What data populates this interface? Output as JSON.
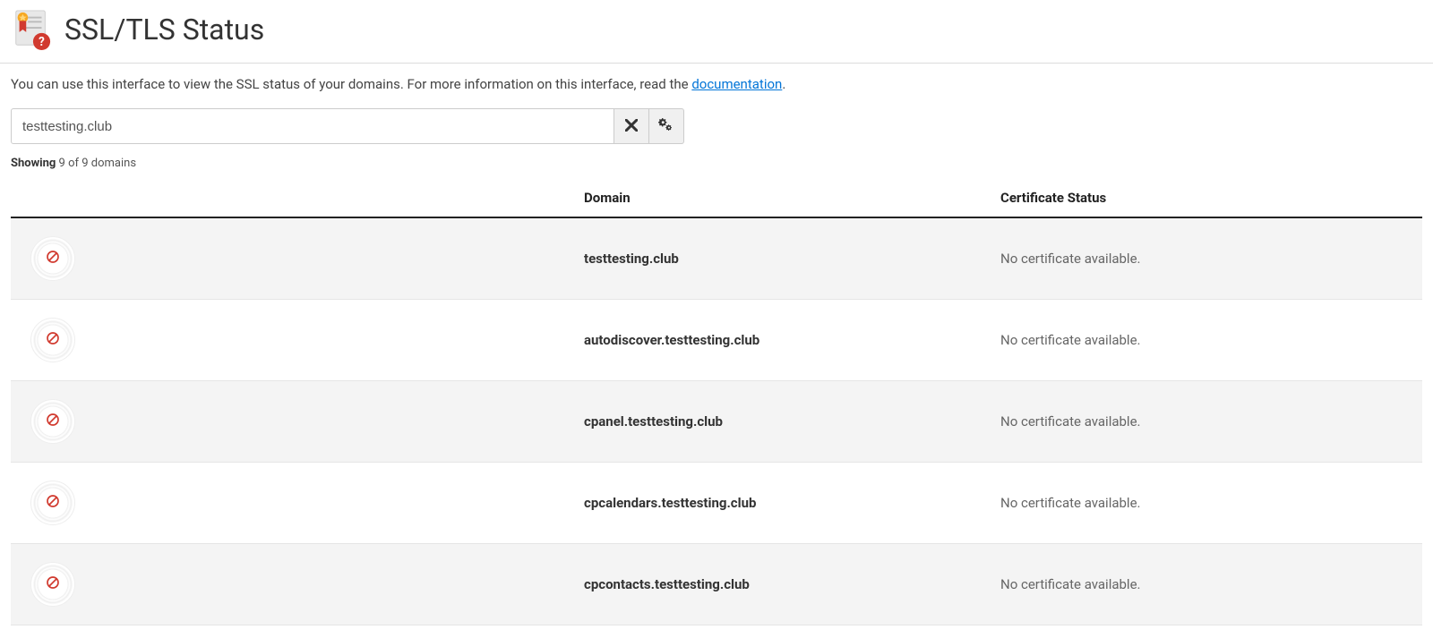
{
  "header": {
    "title": "SSL/TLS Status"
  },
  "intro": {
    "text_before_link": "You can use this interface to view the SSL status of your domains. For more information on this interface, read the ",
    "link_text": "documentation",
    "text_after_link": "."
  },
  "search": {
    "value": "testtesting.club"
  },
  "showing": {
    "label": "Showing",
    "rest": " 9 of 9 domains"
  },
  "table": {
    "headers": {
      "domain": "Domain",
      "cert_status": "Certificate Status"
    },
    "rows": [
      {
        "domain": "testtesting.club",
        "status": "No certificate available."
      },
      {
        "domain": "autodiscover.testtesting.club",
        "status": "No certificate available."
      },
      {
        "domain": "cpanel.testtesting.club",
        "status": "No certificate available."
      },
      {
        "domain": "cpcalendars.testtesting.club",
        "status": "No certificate available."
      },
      {
        "domain": "cpcontacts.testtesting.club",
        "status": "No certificate available."
      }
    ]
  }
}
